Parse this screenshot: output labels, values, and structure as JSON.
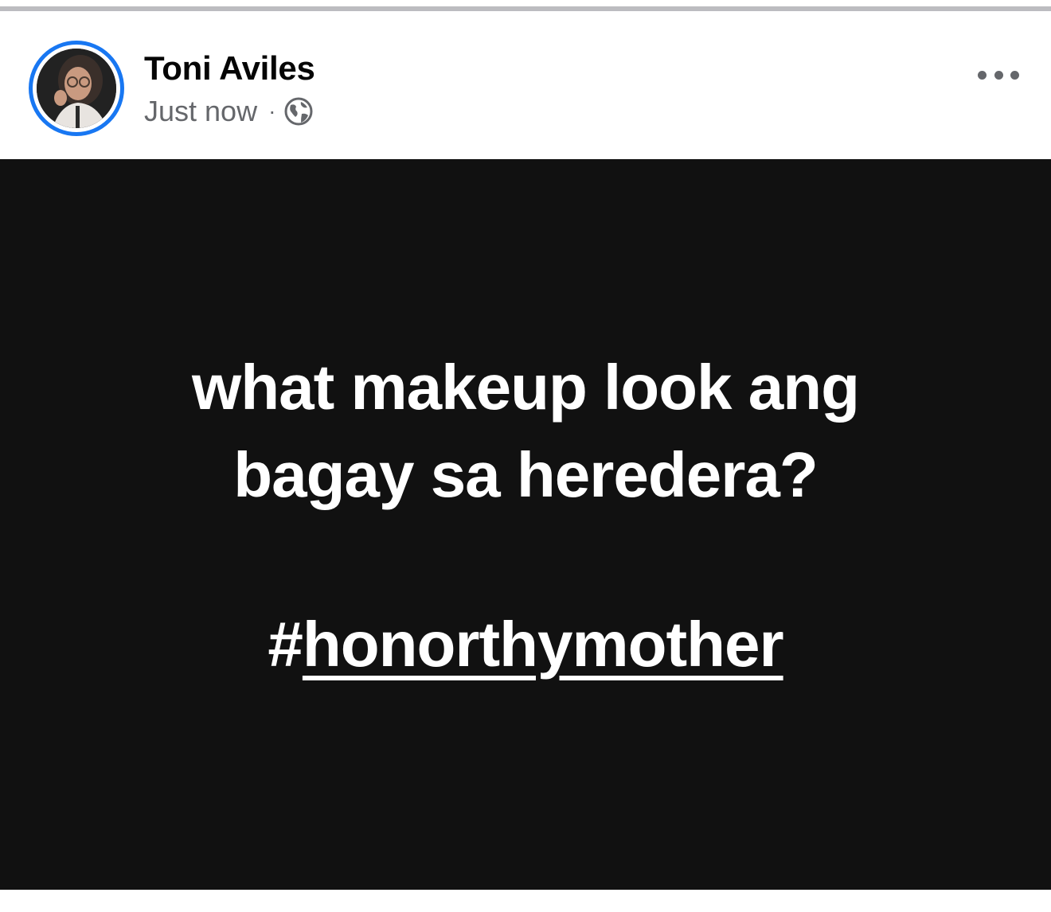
{
  "post": {
    "author_name": "Toni Aviles",
    "timestamp": "Just now",
    "separator": "·",
    "privacy_icon": "globe-icon",
    "more_icon": "more-options-icon",
    "text_line_1": "what makeup look ang",
    "text_line_2": "bagay sa heredera?",
    "hashtag_symbol": "#",
    "hashtag_text": "honorthymother"
  },
  "colors": {
    "avatar_ring": "#1877f2",
    "post_background": "#111111",
    "post_text": "#ffffff",
    "meta_text": "#65676b"
  }
}
